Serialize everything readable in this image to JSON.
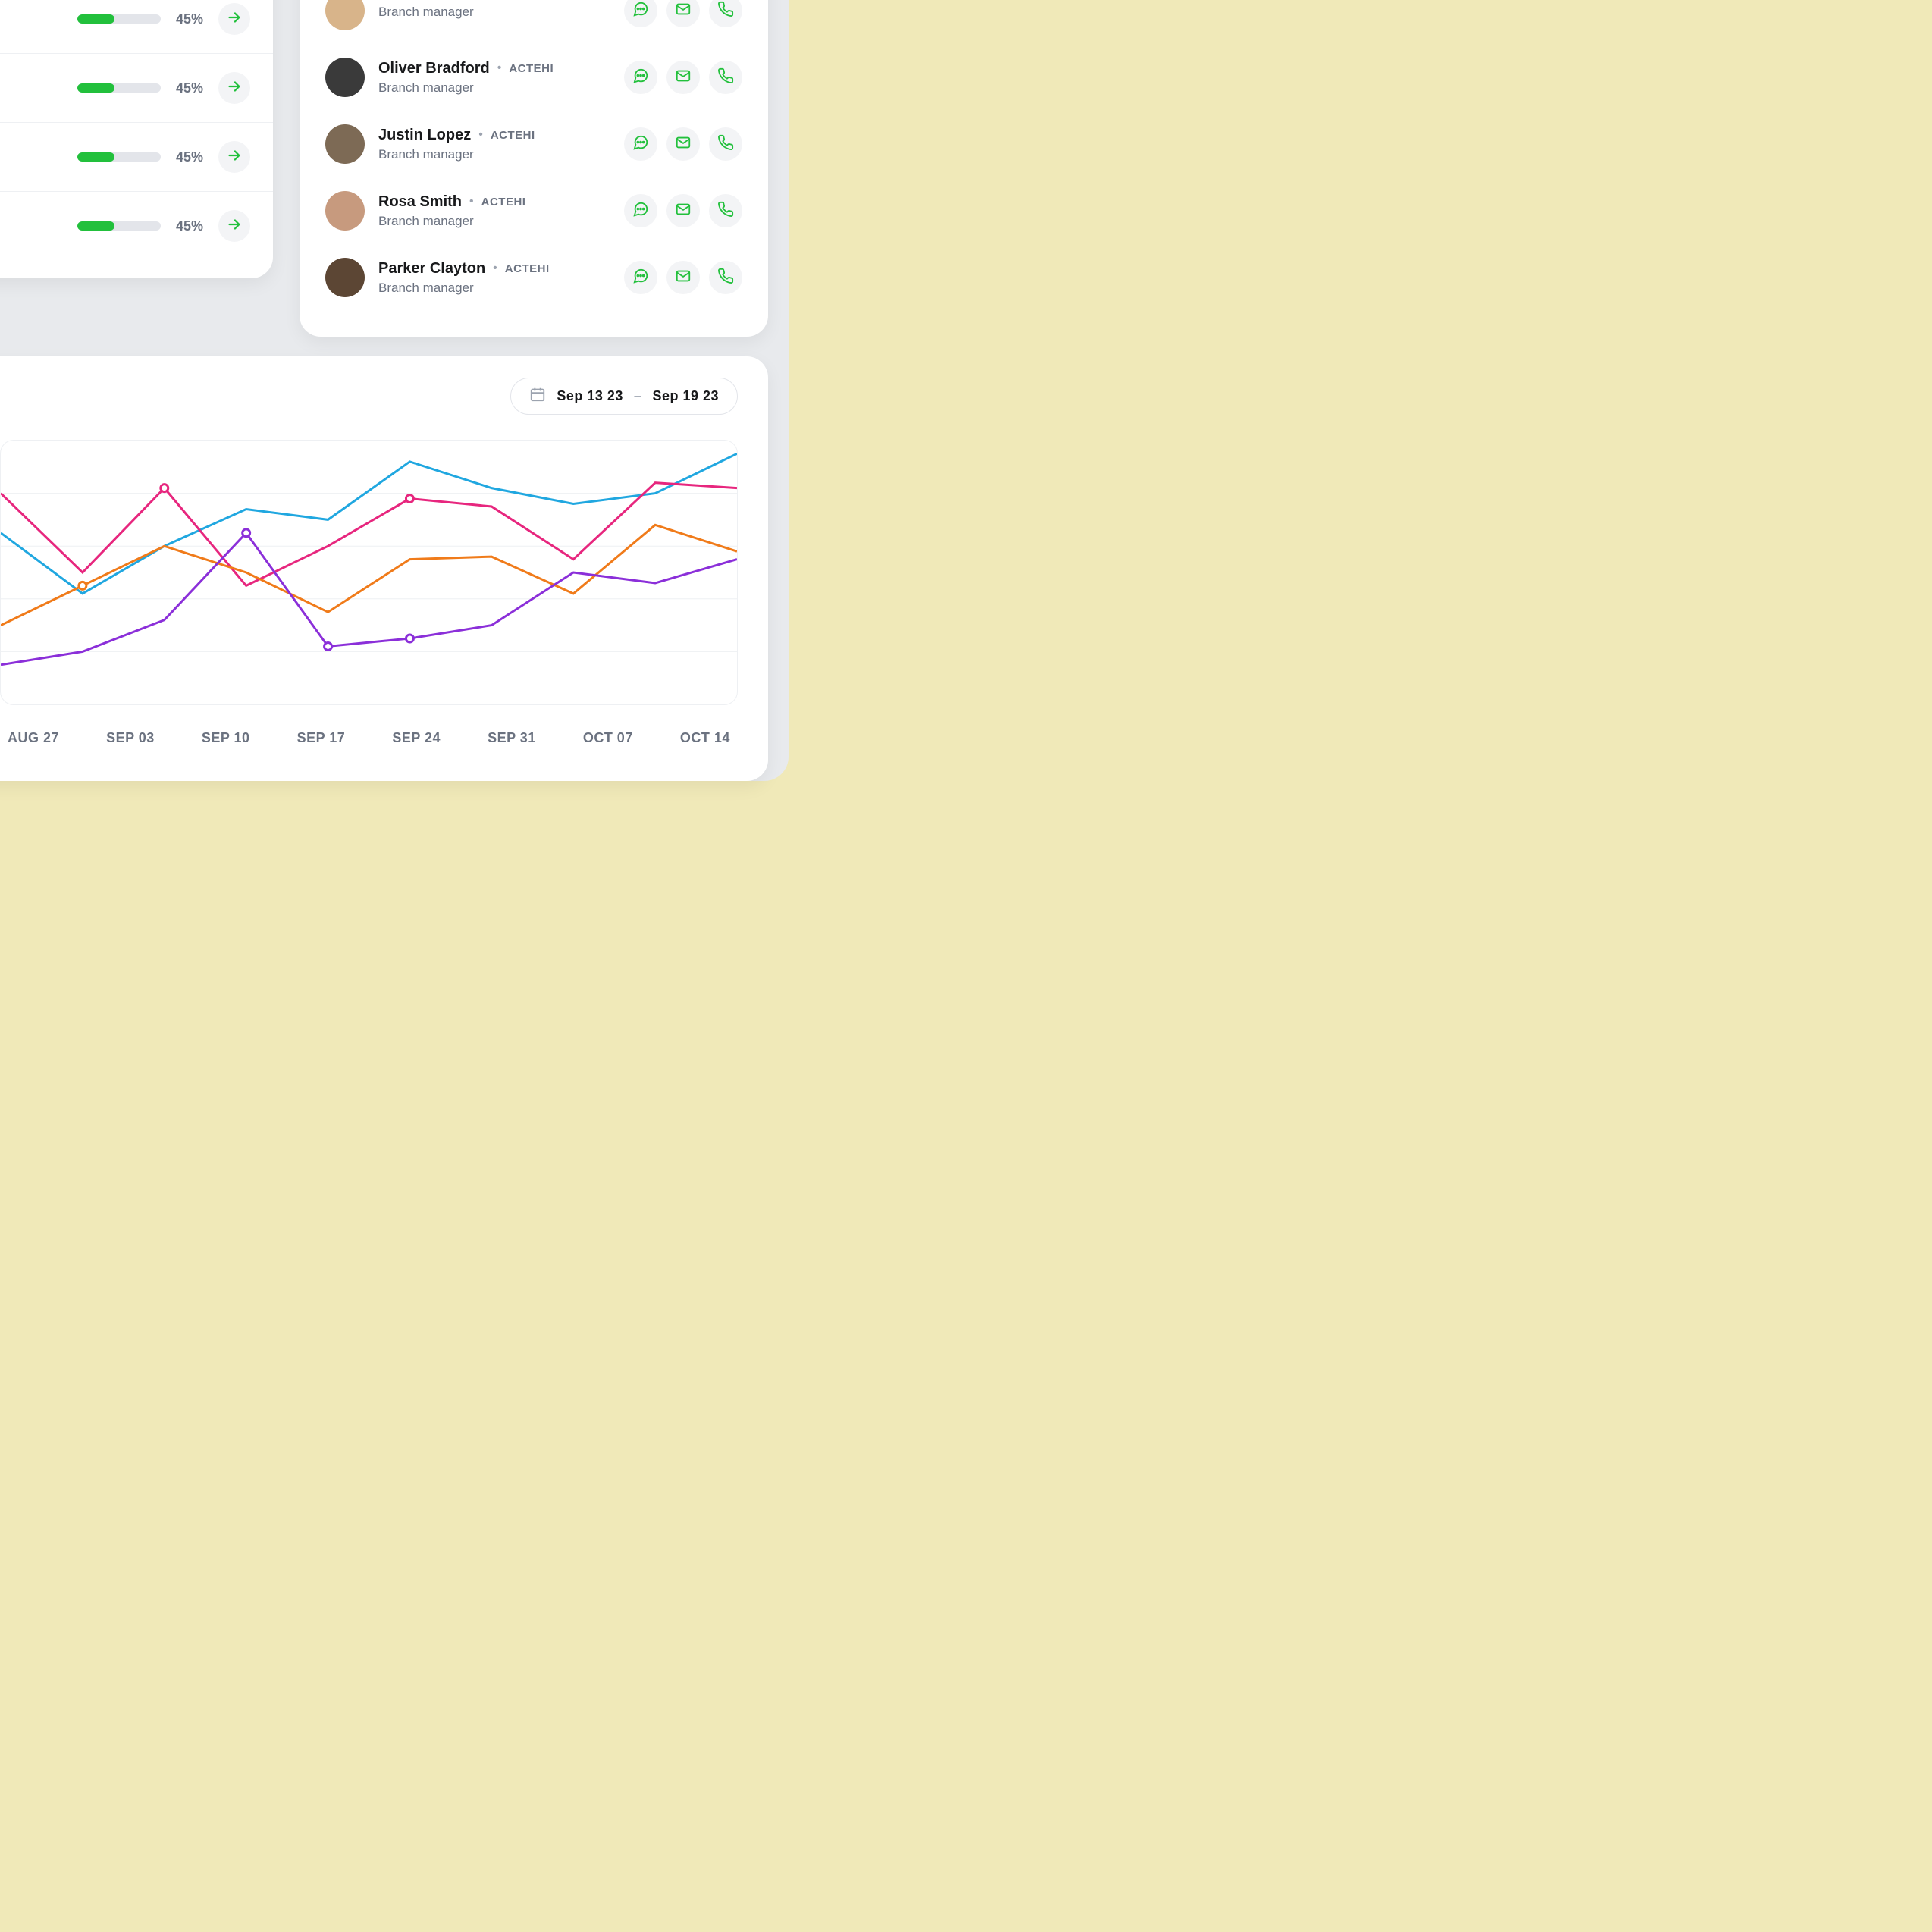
{
  "progress": {
    "rows": [
      {
        "pct": 45,
        "label": "45%"
      },
      {
        "pct": 45,
        "label": "45%"
      },
      {
        "pct": 45,
        "label": "45%"
      },
      {
        "pct": 45,
        "label": "45%"
      }
    ]
  },
  "contacts": {
    "tag": "ACTEHI",
    "items": [
      {
        "name": "",
        "role": "Branch manager",
        "avatarBg": "#d8b48a"
      },
      {
        "name": "Oliver Bradford",
        "role": "Branch manager",
        "avatarBg": "#3a3a3a"
      },
      {
        "name": "Justin Lopez",
        "role": "Branch manager",
        "avatarBg": "#7d6a55"
      },
      {
        "name": "Rosa Smith",
        "role": "Branch manager",
        "avatarBg": "#c79a7e"
      },
      {
        "name": "Parker Clayton",
        "role": "Branch manager",
        "avatarBg": "#5c4634"
      }
    ]
  },
  "dateRange": {
    "from": "Sep 13 23",
    "to": "Sep 19 23"
  },
  "colors": {
    "green": "#22c03c",
    "blue": "#20a7e0",
    "pink": "#e7267e",
    "orange": "#f07b1a",
    "purple": "#8b2fd9"
  },
  "chart_data": {
    "type": "line",
    "categories": [
      "AUG 27",
      "SEP 03",
      "SEP 10",
      "SEP 17",
      "SEP 24",
      "SEP 31",
      "OCT 07",
      "OCT 14"
    ],
    "ylim": [
      0,
      100
    ],
    "series": [
      {
        "name": "blue",
        "color": "#20a7e0",
        "values": [
          65,
          42,
          60,
          74,
          70,
          92,
          82,
          76,
          80,
          95
        ]
      },
      {
        "name": "pink",
        "color": "#e7267e",
        "values": [
          80,
          50,
          82,
          45,
          60,
          78,
          75,
          55,
          84,
          82
        ]
      },
      {
        "name": "orange",
        "color": "#f07b1a",
        "values": [
          30,
          45,
          60,
          50,
          35,
          55,
          56,
          42,
          68,
          58
        ]
      },
      {
        "name": "purple",
        "color": "#8b2fd9",
        "values": [
          15,
          20,
          32,
          65,
          22,
          25,
          30,
          50,
          46,
          55
        ]
      }
    ],
    "markers": [
      {
        "series": "pink",
        "i": 2
      },
      {
        "series": "pink",
        "i": 5
      },
      {
        "series": "orange",
        "i": 1
      },
      {
        "series": "purple",
        "i": 3
      },
      {
        "series": "purple",
        "i": 4
      },
      {
        "series": "purple",
        "i": 5
      }
    ]
  }
}
